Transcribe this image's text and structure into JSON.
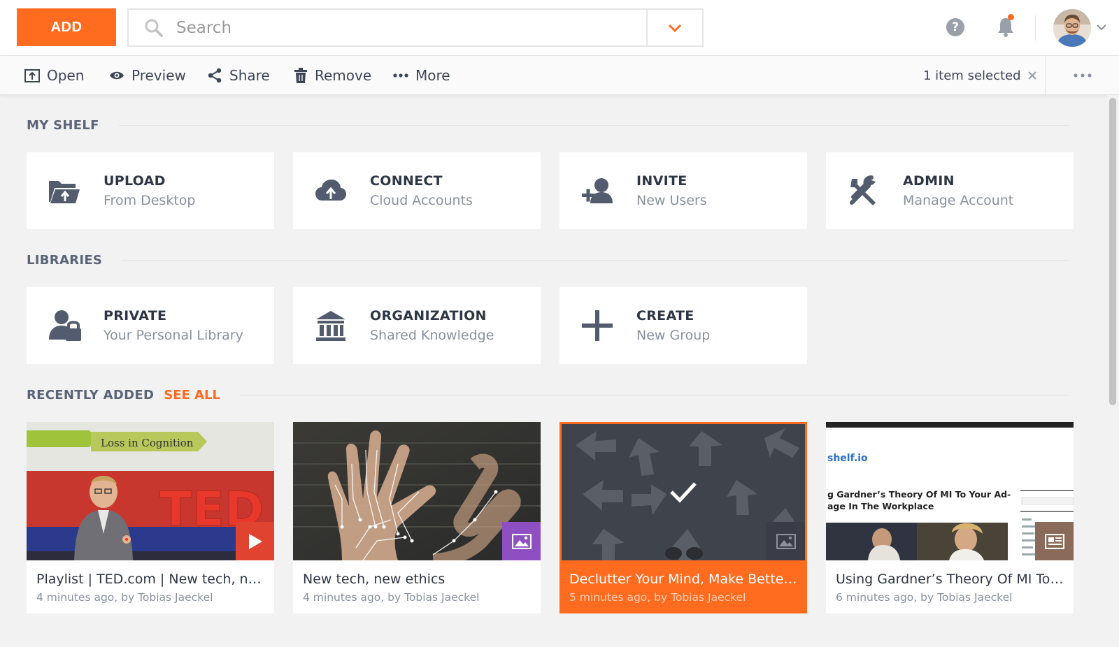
{
  "topbar": {
    "add_label": "ADD",
    "search_placeholder": "Search",
    "help_label": "?"
  },
  "actionbar": {
    "open": "Open",
    "preview": "Preview",
    "share": "Share",
    "remove": "Remove",
    "more": "More",
    "selection": "1 item selected"
  },
  "my_shelf": {
    "title": "MY SHELF",
    "tiles": [
      {
        "title": "UPLOAD",
        "sub": "From Desktop",
        "icon": "folder-upload-icon"
      },
      {
        "title": "CONNECT",
        "sub": "Cloud Accounts",
        "icon": "cloud-upload-icon"
      },
      {
        "title": "INVITE",
        "sub": "New Users",
        "icon": "add-user-icon"
      },
      {
        "title": "ADMIN",
        "sub": "Manage Account",
        "icon": "tools-icon"
      }
    ]
  },
  "libraries": {
    "title": "LIBRARIES",
    "tiles": [
      {
        "title": "PRIVATE",
        "sub": "Your Personal Library",
        "icon": "locked-user-icon"
      },
      {
        "title": "ORGANIZATION",
        "sub": "Shared Knowledge",
        "icon": "bank-icon"
      },
      {
        "title": "CREATE",
        "sub": "New Group",
        "icon": "plus-icon"
      }
    ]
  },
  "recent": {
    "title": "RECENTLY ADDED",
    "see_all": "SEE ALL",
    "cards": [
      {
        "title": "Playlist | TED.com | New tech, new e..",
        "meta": "4 minutes ago, by Tobias Jaeckel",
        "badge": "play-icon",
        "badge_color": "#e0432f",
        "slide_text": "Loss in Cognition",
        "slide_logo": "TED"
      },
      {
        "title": "New tech, new ethics",
        "meta": "4 minutes ago, by Tobias Jaeckel",
        "badge": "image-icon",
        "badge_color": "#8e4fc2"
      },
      {
        "title": "Declutter Your Mind, Make Better D...",
        "meta": "5 minutes ago, by Tobias Jaeckel",
        "badge": "image-icon",
        "badge_color": "#3a3d47",
        "selected": true
      },
      {
        "title": "Using Gardner’s Theory Of MI To Yo...",
        "meta": "6 minutes ago, by Tobias Jaeckel",
        "badge": "article-icon",
        "badge_color": "#8a6a58",
        "page_logo": "shelf.io",
        "page_heading_1": "g Gardner’s Theory Of MI To Your Ad-",
        "page_heading_2": "age In The Workplace"
      }
    ]
  },
  "colors": {
    "accent": "#ff6b1f",
    "text": "#3d4556",
    "muted": "#8a919c",
    "background": "#f2f2f2"
  }
}
